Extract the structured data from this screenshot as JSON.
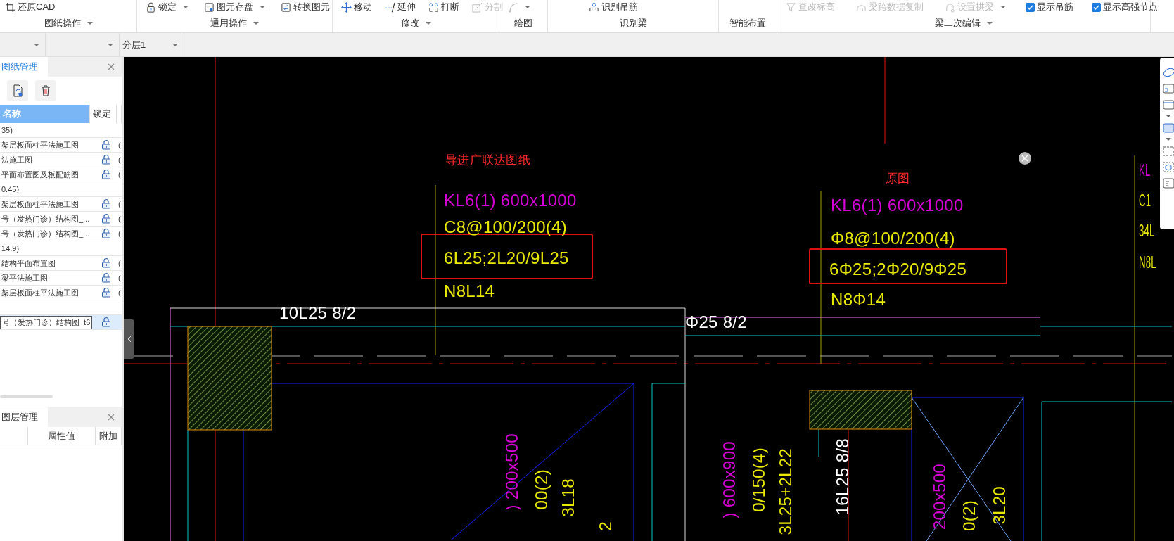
{
  "ribbon": {
    "groups": [
      {
        "label": "图纸操作",
        "dropdown": true,
        "items": [
          {
            "kind": "button",
            "label": "还原CAD",
            "disabled": false,
            "dropdown": false
          }
        ]
      },
      {
        "label": "通用操作",
        "dropdown": true,
        "items": [
          {
            "kind": "button",
            "label": "锁定",
            "disabled": false,
            "dropdown": true
          },
          {
            "kind": "button",
            "label": "图元存盘",
            "disabled": false,
            "dropdown": true
          },
          {
            "kind": "button",
            "label": "转换图元",
            "disabled": false,
            "dropdown": false
          }
        ]
      },
      {
        "label": "修改",
        "dropdown": true,
        "items": [
          {
            "kind": "button",
            "label": "移动",
            "disabled": false,
            "dropdown": false
          },
          {
            "kind": "button",
            "label": "延伸",
            "disabled": false,
            "dropdown": false
          },
          {
            "kind": "button",
            "label": "打断",
            "disabled": false,
            "dropdown": false
          },
          {
            "kind": "button",
            "label": "分割",
            "disabled": true,
            "dropdown": false
          }
        ]
      },
      {
        "label": "绘图",
        "dropdown": false,
        "items": [
          {
            "kind": "tool",
            "disabled": true,
            "dropdown": true
          }
        ]
      },
      {
        "label": "识别梁",
        "dropdown": false,
        "items": [
          {
            "kind": "button",
            "label": "识别吊筋",
            "disabled": false,
            "dropdown": false
          }
        ]
      },
      {
        "label": "智能布置",
        "dropdown": false
      },
      {
        "label": "梁二次编辑",
        "dropdown": true,
        "items": [
          {
            "kind": "button",
            "label": "查改标高",
            "disabled": true,
            "dropdown": false
          },
          {
            "kind": "button",
            "label": "梁跨数据复制",
            "disabled": true,
            "dropdown": false
          },
          {
            "kind": "button",
            "label": "设置拱梁",
            "disabled": true,
            "dropdown": true
          },
          {
            "kind": "checkbox",
            "label": "显示吊筋",
            "checked": true
          },
          {
            "kind": "checkbox",
            "label": "显示高强节点",
            "checked": true
          }
        ]
      }
    ]
  },
  "selectors": [
    {
      "kind": "empty"
    },
    {
      "kind": "empty"
    },
    {
      "kind": "value",
      "value": "分层1"
    }
  ],
  "drawing_panel": {
    "tabs": [
      {
        "label": "图纸管理",
        "selected": true
      }
    ],
    "columns": [
      "名称",
      "锁定"
    ],
    "tree": [
      {
        "label": "35)",
        "children": [
          {
            "label": "架层板面柱平法施工图",
            "column_3": "(",
            "selected": false
          },
          {
            "label": "法施工图",
            "column_3": "(",
            "selected": false
          },
          {
            "label": "平面布置图及板配筋图",
            "column_3": "(",
            "selected": false
          }
        ]
      },
      {
        "label": "0.45)",
        "children": [
          {
            "label": "架层板面柱平法施工图",
            "column_3": "(",
            "selected": false
          },
          {
            "label": "号（发热门诊）结构图_...",
            "column_3": "(",
            "selected": false
          },
          {
            "label": "号（发热门诊）结构图_...",
            "column_3": "(",
            "selected": false
          }
        ]
      },
      {
        "label": "14.9)",
        "children": [
          {
            "label": "结构平面布置图",
            "column_3": "(",
            "selected": false
          },
          {
            "label": "梁平法施工图",
            "column_3": "(",
            "selected": false
          },
          {
            "label": "架层板面柱平法施工图",
            "column_3": "(",
            "selected": false
          }
        ]
      },
      {
        "children": [
          {
            "label": "号（发热门诊）结构图_t6",
            "selected": true
          }
        ]
      }
    ]
  },
  "layer_panel": {
    "title": "图层管理",
    "columns": [
      "属性值",
      "附加"
    ]
  },
  "drawing": {
    "labels": [
      {
        "text": "导进广联达图纸",
        "kind": "note"
      },
      {
        "text": "KL6(1) 600x1000",
        "kind": "beam-name"
      },
      {
        "text": "C8@100/200(4)",
        "kind": "rebar"
      },
      {
        "text": "6L25;2L20/9L25",
        "kind": "rebar"
      },
      {
        "text": "N8L14",
        "kind": "rebar"
      },
      {
        "text": "原图",
        "kind": "note"
      },
      {
        "text": "KL6(1) 600x1000",
        "kind": "beam-name"
      },
      {
        "text": "Φ8@100/200(4)",
        "kind": "rebar"
      },
      {
        "text": "6Φ25;2Φ20/9Φ25",
        "kind": "rebar"
      },
      {
        "text": "N8Φ14",
        "kind": "rebar"
      },
      {
        "text": "KL",
        "kind": "beam-name"
      },
      {
        "text": "C1",
        "kind": "rebar"
      },
      {
        "text": "34L",
        "kind": "rebar"
      },
      {
        "text": "N8L",
        "kind": "rebar"
      },
      {
        "text": "10L25 8/2",
        "kind": "dimension"
      },
      {
        "text": "Φ25 8/2",
        "kind": "dimension"
      },
      {
        "text": ") 200x500",
        "kind": "beam-name"
      },
      {
        "text": "00(2)",
        "kind": "rebar"
      },
      {
        "text": "3L18",
        "kind": "rebar"
      },
      {
        "text": "2",
        "kind": "rebar"
      },
      {
        "text": ") 600x900",
        "kind": "beam-name"
      },
      {
        "text": "0/150(4)",
        "kind": "rebar"
      },
      {
        "text": "3L25+2L22",
        "kind": "rebar"
      },
      {
        "text": "16L25 8/8",
        "kind": "dimension"
      },
      {
        "text": "200x500",
        "kind": "beam-name"
      },
      {
        "text": "0(2)",
        "kind": "rebar"
      },
      {
        "text": "3L20",
        "kind": "rebar"
      }
    ]
  }
}
